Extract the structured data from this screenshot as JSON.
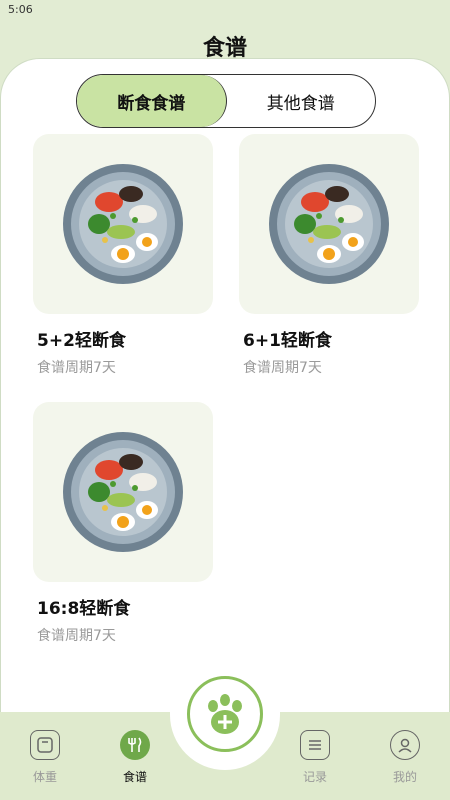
{
  "status_bar": {
    "time": "5:06"
  },
  "header": {
    "title": "食谱"
  },
  "tabs": [
    {
      "label": "断食食谱",
      "active": true
    },
    {
      "label": "其他食谱",
      "active": false
    }
  ],
  "recipes": [
    {
      "title": "5+2轻断食",
      "subtitle": "食谱周期7天"
    },
    {
      "title": "6+1轻断食",
      "subtitle": "食谱周期7天"
    },
    {
      "title": "16:8轻断食",
      "subtitle": "食谱周期7天"
    }
  ],
  "bottom_nav": [
    {
      "label": "体重",
      "icon": "scale-icon",
      "active": false
    },
    {
      "label": "食谱",
      "icon": "fork-knife-icon",
      "active": true
    },
    {
      "label": "记录",
      "icon": "list-icon",
      "active": false
    },
    {
      "label": "我的",
      "icon": "profile-icon",
      "active": false
    }
  ],
  "center_button": {
    "icon": "paw-add-icon"
  },
  "colors": {
    "accent": "#8bbf5b",
    "tab_active_bg": "#c9e3a3",
    "nav_bg": "#dfeacd",
    "card_bg": "#f3f6ec"
  }
}
